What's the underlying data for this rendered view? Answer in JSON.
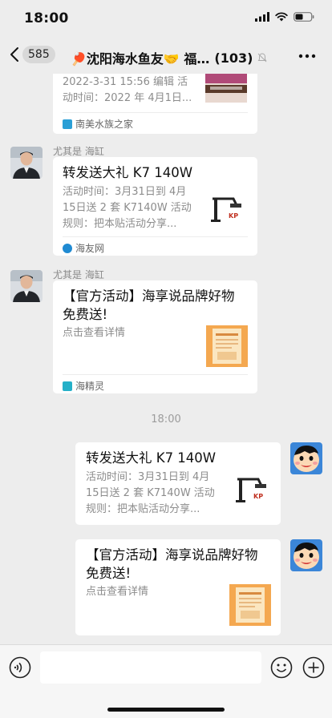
{
  "status": {
    "time": "18:00"
  },
  "nav": {
    "back_count": "585",
    "title": "🏓沈阳海水鱼友🤝 福…",
    "member_count": "(103)"
  },
  "messages": {
    "top_card": {
      "desc_line1": "2022-3-31 15:56 编辑 活",
      "desc_line2": "动时间：2022 年 4月1日...",
      "source": "南美水族之家",
      "source_color": "#2a9fd6"
    },
    "msg1": {
      "sender": "尤其是 海缸",
      "title": "转发送大礼 K7 140W",
      "desc": [
        "活动时间：3月31日到 4月",
        "15日送 2 套 K7140W 活动",
        "规则：把本贴活动分享..."
      ],
      "source": "海友网",
      "source_color": "#1f8ad2"
    },
    "msg2": {
      "sender": "尤其是 海缸",
      "title": [
        "【官方活动】海享说品牌好物",
        "免费送!"
      ],
      "desc": "点击查看详情",
      "source": "海精灵",
      "source_color": "#25b0c8"
    },
    "timestamp": "18:00",
    "msg3": {
      "title": "转发送大礼 K7 140W",
      "desc": [
        "活动时间：3月31日到 4月",
        "15日送 2 套 K7140W 活动",
        "规则：把本贴活动分享..."
      ]
    },
    "msg4": {
      "title": [
        "【官方活动】海享说品牌好物",
        "免费送!"
      ],
      "desc": "点击查看详情"
    }
  },
  "input": {
    "placeholder": ""
  },
  "colors": {
    "chat_bg": "#ededed",
    "accent_blue": "#3a8ee6"
  },
  "icons": [
    "back-icon",
    "mute-icon",
    "more-icon",
    "voice-icon",
    "emoji-icon",
    "plus-icon"
  ]
}
